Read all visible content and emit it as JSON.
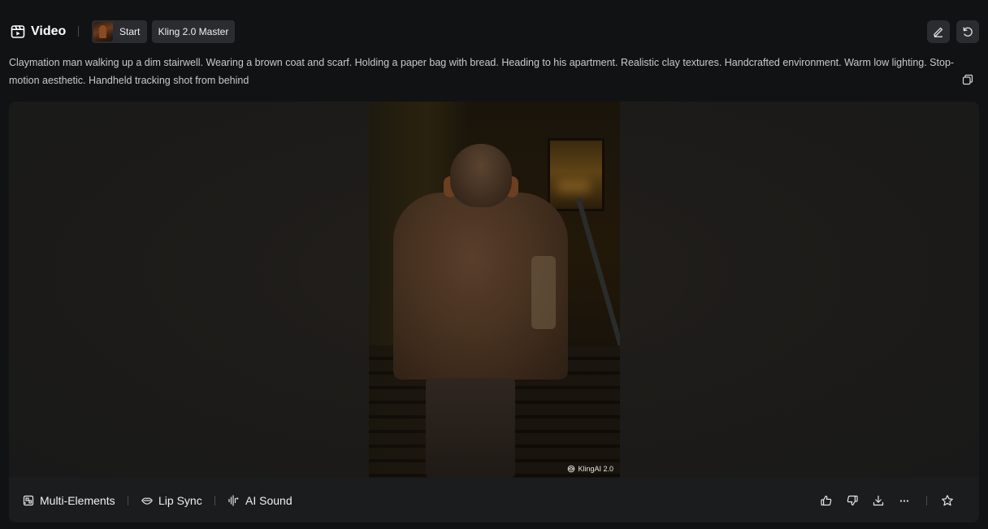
{
  "header": {
    "title": "Video",
    "start_label": "Start",
    "model_label": "Kling 2.0 Master"
  },
  "prompt": {
    "text": "Claymation man walking up a dim stairwell. Wearing a brown coat and scarf. Holding a paper bag with bread. Heading to his apartment. Realistic clay textures. Handcrafted environment. Warm low lighting. Stop-motion aesthetic. Handheld tracking shot from behind"
  },
  "video": {
    "watermark": "KlingAI 2.0"
  },
  "toolbar": {
    "multi_elements": "Multi-Elements",
    "lip_sync": "Lip Sync",
    "ai_sound": "AI Sound"
  },
  "icons": {
    "title": "video-icon",
    "edit": "pencil-icon",
    "redo": "rotate-ccw-icon",
    "copy": "copy-icon",
    "like": "thumbs-up-icon",
    "dislike": "thumbs-down-icon",
    "download": "download-icon",
    "more": "more-horizontal-icon",
    "favorite": "star-icon"
  },
  "colors": {
    "background": "#111213",
    "card": "#1b1c1e",
    "chip": "#2b2c2f",
    "text": "#e8e8e8",
    "muted_text": "#c9cacc"
  }
}
